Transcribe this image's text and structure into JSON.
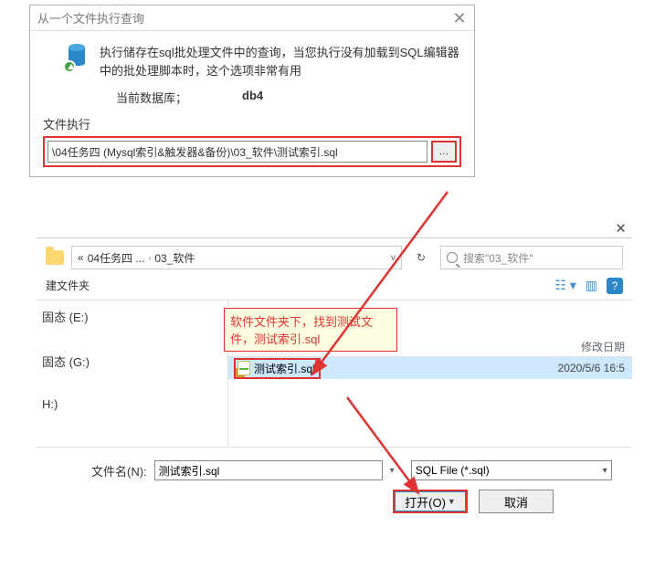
{
  "dialog1": {
    "title": "从一个文件执行查询",
    "message": "执行储存在sql批处理文件中的查询，当您执行没有加载到SQL编辑器中的批处理脚本时，这个选项非常有用",
    "current_db_label": "当前数据库；",
    "current_db_value": "db4",
    "exec_label": "文件执行",
    "path_value": "\\04任务四 (Mysql索引&触发器&备份)\\03_软件\\测试索引.sql",
    "browse_label": "…"
  },
  "callout": {
    "text": "软件文件夹下，找到测试文件，测试索引.sql"
  },
  "dialog2": {
    "breadcrumb_prefix": "«",
    "breadcrumb_part1": "04任务四 ...",
    "breadcrumb_part2": "03_软件",
    "search_placeholder": "搜索\"03_软件\"",
    "new_folder_label": "建文件夹",
    "help_label": "?",
    "sidebar_items": [
      {
        "label": "固态 (E:)"
      },
      {
        "label": "固态 (G:)"
      },
      {
        "label": "H:)"
      }
    ],
    "col_date_label": "修改日期",
    "file": {
      "name": "测试索引.sql",
      "date": "2020/5/6 16:5"
    },
    "filename_label": "文件名(N):",
    "filename_value": "测试索引.sql",
    "filetype_value": "SQL File (*.sql)",
    "open_label": "打开(O)",
    "cancel_label": "取消"
  }
}
